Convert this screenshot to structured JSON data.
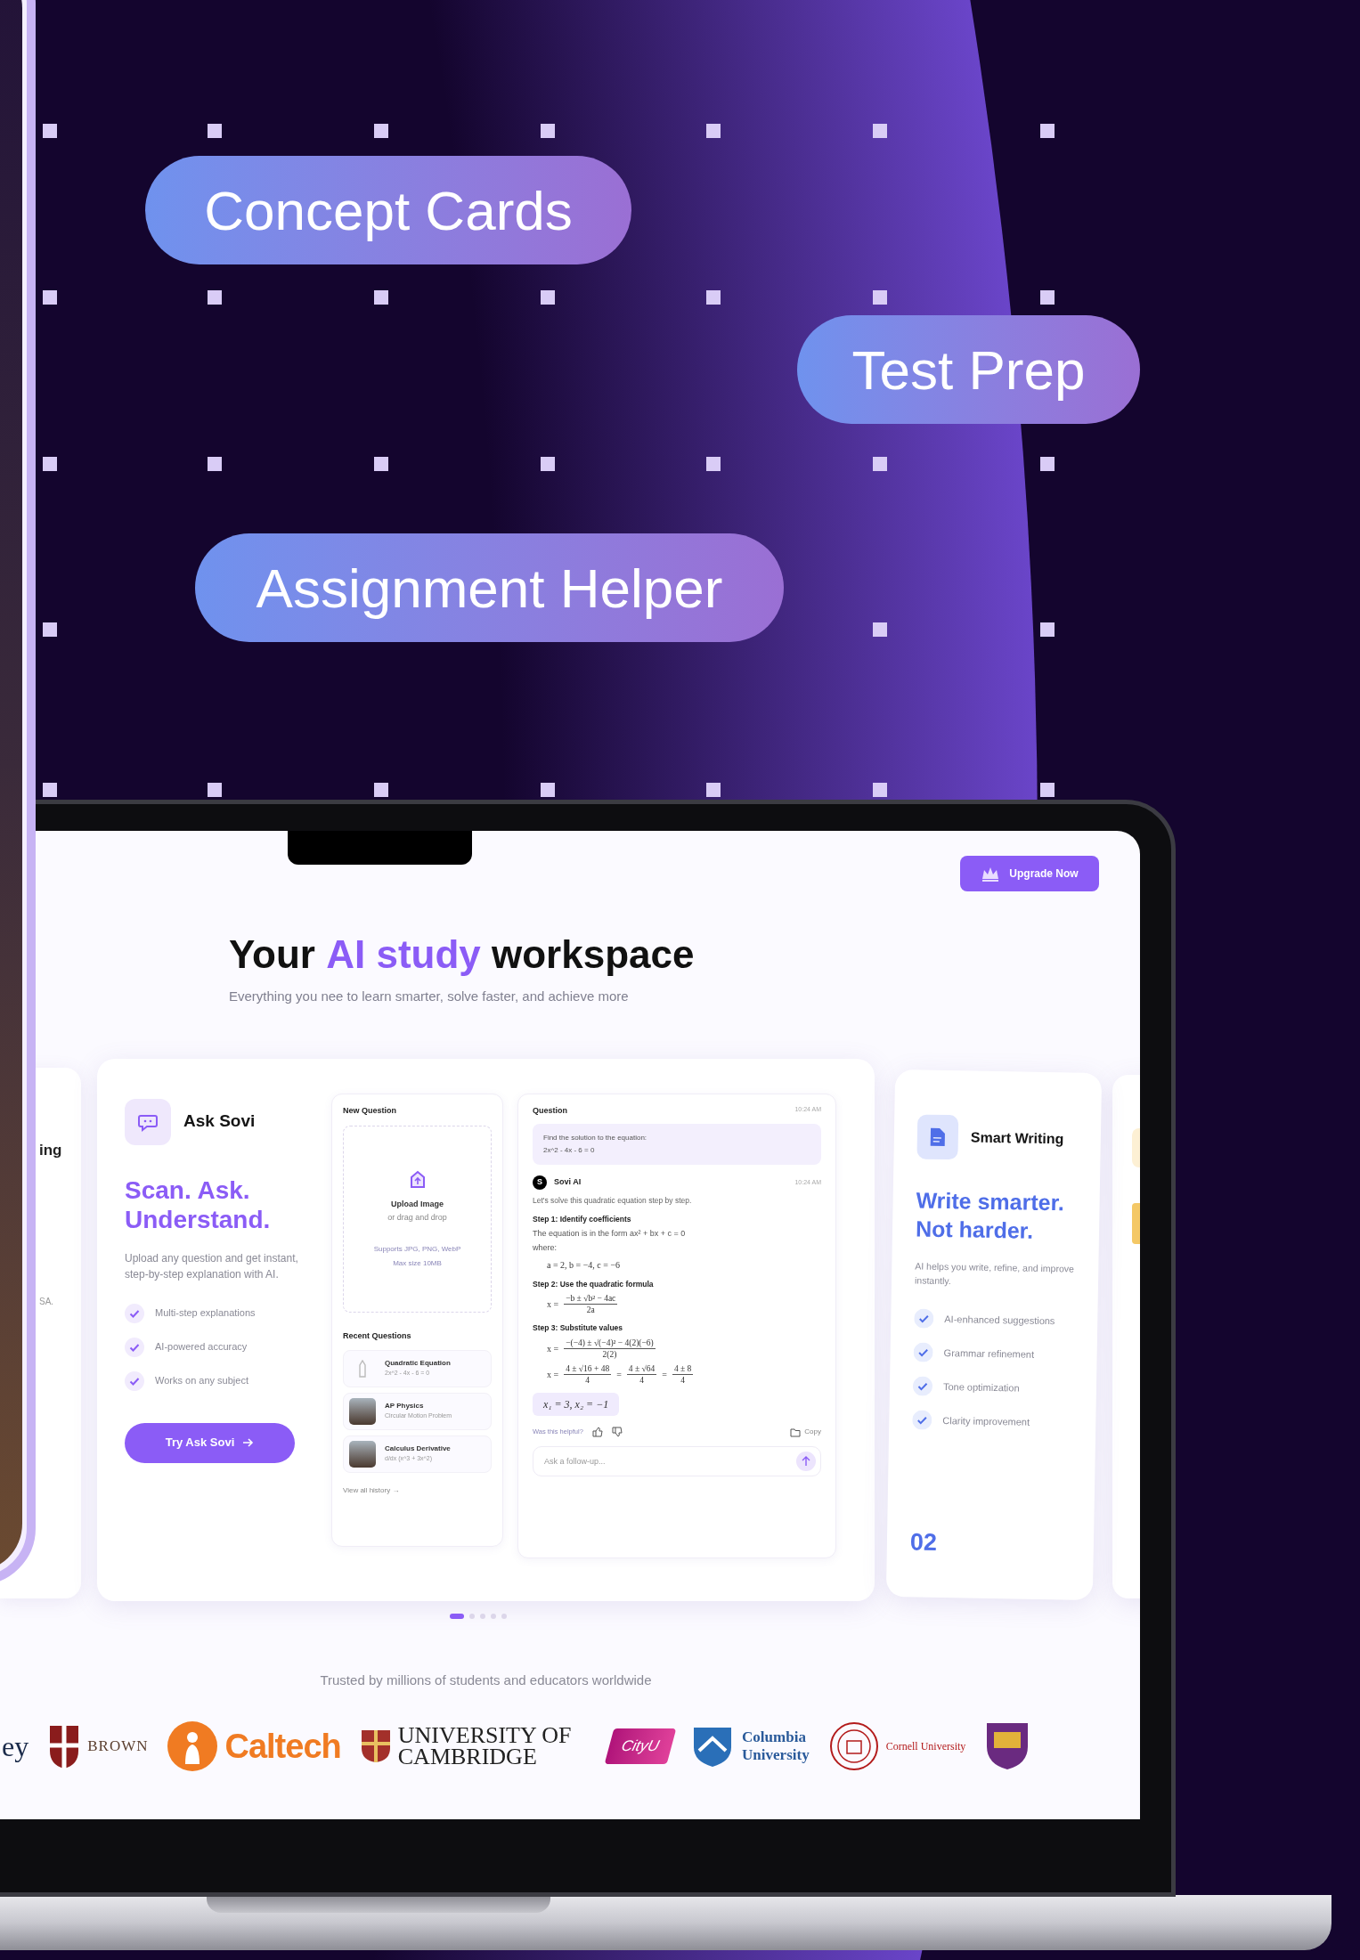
{
  "feature_pills": [
    {
      "label": "Concept Cards"
    },
    {
      "label": "Test Prep"
    },
    {
      "label": "Assignment Helper"
    }
  ],
  "laptop_screen": {
    "upgrade_button": "Upgrade Now",
    "title_parts": [
      {
        "text": "Your ",
        "highlight": false
      },
      {
        "text": "AI study",
        "highlight": true
      },
      {
        "text": " workspace",
        "highlight": false
      }
    ],
    "subtitle": "Everything you nee to learn smarter, solve faster, and achieve more",
    "left_card_fragment": {
      "title": "ing",
      "note": "SA."
    },
    "feature_card": {
      "title": "Ask Sovi",
      "headline_lines": [
        "Scan. Ask.",
        "Understand."
      ],
      "description": "Upload any question and get instant, step-by-step explanation with AI.",
      "features": [
        "Multi-step explanations",
        "AI-powered accuracy",
        "Works on any subject"
      ],
      "button": "Try Ask Sovi"
    },
    "new_question": {
      "title": "New Question",
      "upload_title": "Upload Image",
      "upload_hint": "or drag and drop",
      "formats": "Supports JPG, PNG, WebP",
      "max_size": "Max size 10MB",
      "recent_title": "Recent Questions",
      "recent": [
        {
          "kind": "icon",
          "title": "Quadratic Equation",
          "subtitle": "2x^2 - 4x - 6 = 0"
        },
        {
          "kind": "photo",
          "title": "AP Physics",
          "subtitle": "Circular Motion Problem"
        },
        {
          "kind": "photo",
          "title": "Calculus Derivative",
          "subtitle": "d/dx (x^3 + 3x^2)"
        }
      ],
      "history_link": "View all history →"
    },
    "chat": {
      "question_label": "Question",
      "question_time": "10:24 AM",
      "question_lines": [
        "Find the solution to the equation:",
        "2x^2 - 4x - 6 = 0"
      ],
      "bot_avatar": "S",
      "bot_name": "Sovi AI",
      "bot_time": "10:24 AM",
      "intro": "Let's solve this quadratic equation step by step.",
      "blocks": [
        {
          "kind": "step",
          "text": "Step 1: Identify coefficients"
        },
        {
          "kind": "text",
          "text": "The equation is in the form ax² + bx + c = 0"
        },
        {
          "kind": "text",
          "text": "where:"
        },
        {
          "kind": "math",
          "terms": [
            {
              "text": "a = 2, b = −4, c = −6"
            }
          ]
        },
        {
          "kind": "step",
          "text": "Step 2: Use the quadratic formula"
        },
        {
          "kind": "math",
          "terms": [
            {
              "text": "x ="
            },
            {
              "num": "−b ± √b² − 4ac",
              "den": "2a"
            }
          ]
        },
        {
          "kind": "step",
          "text": "Step 3: Substitute values"
        },
        {
          "kind": "math",
          "terms": [
            {
              "text": "x ="
            },
            {
              "num": "−(−4) ± √(−4)² − 4(2)(−6)",
              "den": "2(2)"
            }
          ]
        },
        {
          "kind": "math",
          "terms": [
            {
              "text": "x ="
            },
            {
              "num": "4 ± √16 + 48",
              "den": "4"
            },
            {
              "text": "="
            },
            {
              "num": "4 ± √64",
              "den": "4"
            },
            {
              "text": "="
            },
            {
              "num": "4 ± 8",
              "den": "4"
            }
          ]
        },
        {
          "kind": "answer",
          "text": "x₁ = 3,  x₂ = −1"
        }
      ],
      "helpful": "Was this helpful?",
      "copy": "Copy",
      "followup_placeholder": "Ask a follow-up..."
    },
    "writing_card": {
      "title": "Smart Writing",
      "headline_lines": [
        "Write smarter.",
        "Not harder."
      ],
      "description": "AI helps you write, refine, and improve instantly.",
      "features": [
        "AI-enhanced suggestions",
        "Grammar refinement",
        "Tone optimization",
        "Clarity improvement"
      ],
      "number": "02"
    },
    "carousel_dots": [
      {
        "selected": true
      },
      {
        "selected": false
      },
      {
        "selected": false
      },
      {
        "selected": false
      },
      {
        "selected": false
      }
    ],
    "trusted_text": "Trusted by millions of students and educators worldwide",
    "logos": [
      {
        "kind": "plain",
        "lines": [
          "ey"
        ]
      },
      {
        "kind": "brown",
        "lines": [
          "BROWN"
        ]
      },
      {
        "kind": "caltech",
        "lines": [
          "Caltech"
        ]
      },
      {
        "kind": "cambridge",
        "lines": [
          "UNIVERSITY OF",
          "CAMBRIDGE"
        ]
      },
      {
        "kind": "cityu",
        "lines": [
          "CityU"
        ]
      },
      {
        "kind": "columbia",
        "lines": [
          "Columbia",
          "University"
        ]
      },
      {
        "kind": "cornell",
        "lines": [
          "Cornell University"
        ]
      },
      {
        "kind": "crest"
      }
    ]
  }
}
